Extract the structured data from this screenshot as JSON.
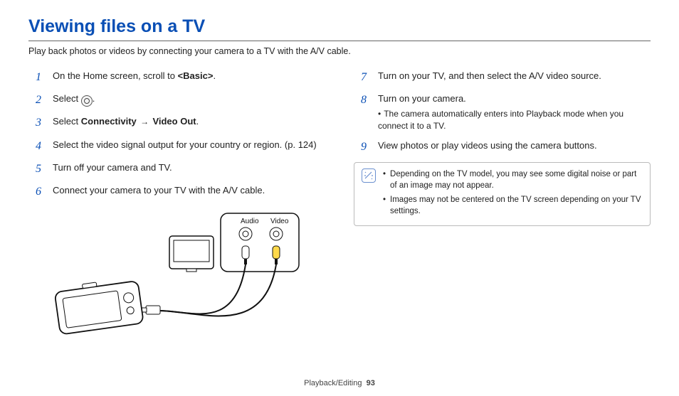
{
  "title": "Viewing files on a TV",
  "intro": "Play back photos or videos by connecting your camera to a TV with the A/V cable.",
  "left_steps": [
    {
      "num": "1",
      "parts": [
        {
          "t": "On the Home screen, scroll to "
        },
        {
          "t": "<Basic>",
          "bold": true
        },
        {
          "t": "."
        }
      ]
    },
    {
      "num": "2",
      "parts": [
        {
          "t": "Select "
        },
        {
          "icon": "playback-icon"
        },
        {
          "t": "."
        }
      ]
    },
    {
      "num": "3",
      "parts": [
        {
          "t": "Select "
        },
        {
          "t": "Connectivity",
          "bold": true
        },
        {
          "t": " → ",
          "arrow": true
        },
        {
          "t": "Video Out",
          "bold": true
        },
        {
          "t": "."
        }
      ]
    },
    {
      "num": "4",
      "parts": [
        {
          "t": "Select the video signal output for your country or region. (p. 124)"
        }
      ]
    },
    {
      "num": "5",
      "parts": [
        {
          "t": "Turn off your camera and TV."
        }
      ]
    },
    {
      "num": "6",
      "parts": [
        {
          "t": "Connect your camera to your TV with the A/V cable."
        }
      ]
    }
  ],
  "illus": {
    "audio_label": "Audio",
    "video_label": "Video"
  },
  "right_steps": [
    {
      "num": "7",
      "parts": [
        {
          "t": "Turn on your TV, and then select the A/V video source."
        }
      ]
    },
    {
      "num": "8",
      "parts": [
        {
          "t": "Turn on your camera."
        }
      ],
      "sub": [
        "The camera automatically enters into Playback mode when you connect it to a TV."
      ]
    },
    {
      "num": "9",
      "parts": [
        {
          "t": "View photos or play videos using the camera buttons."
        }
      ]
    }
  ],
  "notes": [
    "Depending on the TV model, you may see some digital noise or part of an image may not appear.",
    "Images may not be centered on the TV screen depending on your TV settings."
  ],
  "footer_section": "Playback/Editing",
  "footer_page": "93"
}
